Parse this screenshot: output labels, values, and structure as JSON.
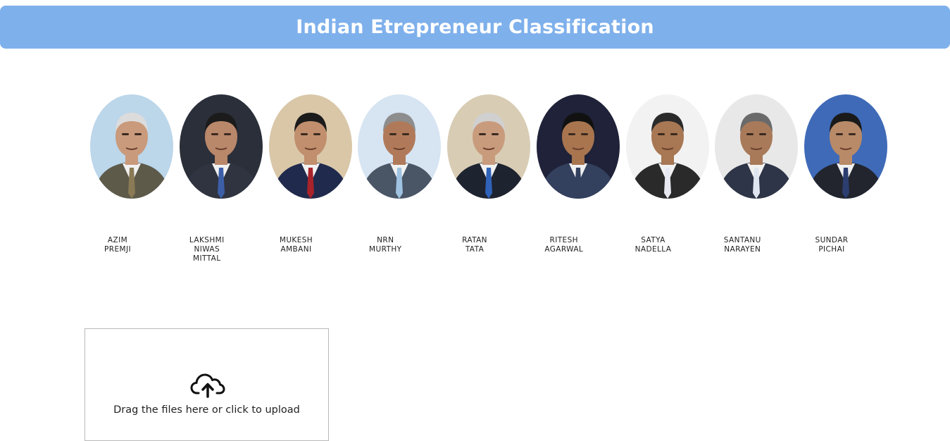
{
  "header": {
    "title": "Indian Etrepreneur Classification"
  },
  "people": [
    {
      "label": "AZIM\nPREMJI",
      "bg": "#bcd6ea",
      "suit": "#5d5a4a",
      "skin": "#c99a7c",
      "hair": "#dcdcdc",
      "tie": "#8a7a55"
    },
    {
      "label": "LAKSHMI\nNIWAS\nMITTAL",
      "bg": "#2b2f3a",
      "suit": "#2f3440",
      "skin": "#b9876a",
      "hair": "#1b1b1b",
      "tie": "#3d5fa8"
    },
    {
      "label": "MUKESH\nAMBANI",
      "bg": "#d9c7a8",
      "suit": "#1f2a4d",
      "skin": "#c18f6e",
      "hair": "#1b1b1b",
      "tie": "#a8232a"
    },
    {
      "label": "NRN\nMURTHY",
      "bg": "#d7e4f2",
      "suit": "#4a5566",
      "skin": "#b07a5a",
      "hair": "#8d8d8d",
      "tie": "#9fc3e0"
    },
    {
      "label": "RATAN\nTATA",
      "bg": "#d8ccb4",
      "suit": "#1e2330",
      "skin": "#c99b7d",
      "hair": "#d0d0d0",
      "tie": "#2f62b8"
    },
    {
      "label": "RITESH\nAGARWAL",
      "bg": "#1f2238",
      "suit": "#33405e",
      "skin": "#a8754f",
      "hair": "#111111",
      "tie": "#33405e"
    },
    {
      "label": "SATYA\nNADELLA",
      "bg": "#f2f2f2",
      "suit": "#2a2a2a",
      "skin": "#a87753",
      "hair": "#2a2a2a",
      "tie": "#e8e8f2"
    },
    {
      "label": "SANTANU\nNARAYEN",
      "bg": "#e8e8e8",
      "suit": "#2e3548",
      "skin": "#a87a5a",
      "hair": "#6a6a6a",
      "tie": "#dfe6f0"
    },
    {
      "label": "SUNDAR\nPICHAI",
      "bg": "#3f6ab8",
      "suit": "#22252e",
      "skin": "#b88a68",
      "hair": "#1a1a1a",
      "tie": "#2c3d70"
    }
  ],
  "upload": {
    "icon": "cloud-upload-icon",
    "text": "Drag the files here or click to upload"
  }
}
